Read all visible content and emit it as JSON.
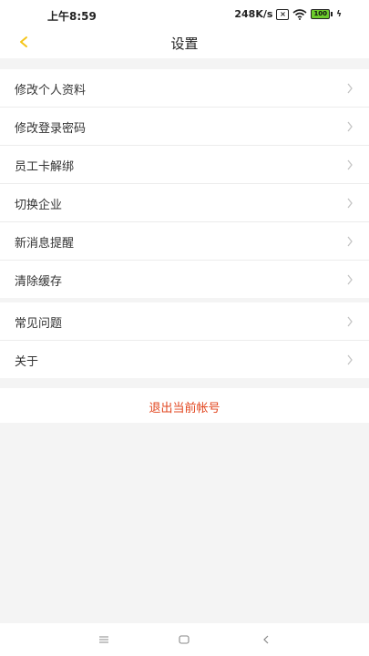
{
  "status_bar": {
    "time": "上午8:59",
    "network_speed": "248K/s",
    "battery_level": "100",
    "icons": [
      "sim-x-icon",
      "wifi-icon",
      "battery-icon",
      "charging-icon"
    ]
  },
  "header": {
    "title": "设置",
    "back_icon": "chevron-left-icon",
    "accent_color": "#f5c518"
  },
  "settings_group_1": [
    {
      "label": "修改个人资料"
    },
    {
      "label": "修改登录密码"
    },
    {
      "label": "员工卡解绑"
    },
    {
      "label": "切换企业"
    },
    {
      "label": "新消息提醒"
    },
    {
      "label": "清除缓存"
    }
  ],
  "settings_group_2": [
    {
      "label": "常见问题"
    },
    {
      "label": "关于"
    }
  ],
  "logout": {
    "label": "退出当前帐号",
    "color": "#e2461f"
  },
  "system_nav": {
    "icons": [
      "menu-icon",
      "home-icon",
      "back-icon"
    ]
  }
}
